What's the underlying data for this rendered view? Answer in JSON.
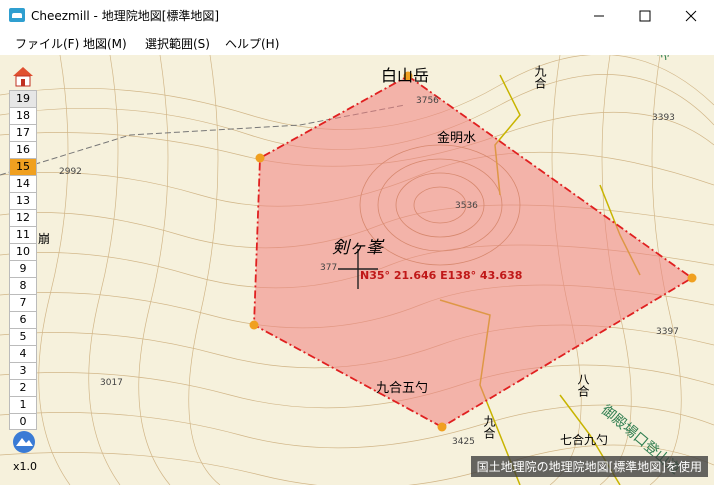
{
  "window": {
    "title": "Cheezmill - 地理院地図[標準地図]",
    "minimize_icon": "minimize-icon",
    "maximize_icon": "maximize-icon",
    "close_icon": "close-icon"
  },
  "menu": {
    "items": [
      {
        "label": "ファイル(F)"
      },
      {
        "label": "地図(M)"
      },
      {
        "label": "選択範囲(S)"
      },
      {
        "label": "ヘルプ(H)"
      }
    ]
  },
  "zoom": {
    "home_icon": "home-icon",
    "levels": [
      "19",
      "18",
      "17",
      "16",
      "15",
      "14",
      "13",
      "12",
      "11",
      "10",
      "9",
      "8",
      "7",
      "6",
      "5",
      "4",
      "3",
      "2",
      "1",
      "0"
    ],
    "active_level": "15",
    "globe_icon": "globe-icon",
    "factor": "x1.0"
  },
  "map": {
    "labels": {
      "hakusan": "白山岳",
      "kinmeisui": "金明水",
      "kengamine": "剣ヶ峯",
      "kugogoshaku": "九合五勺",
      "kugo_top": "九合",
      "kugo_bottom": "九合",
      "hachigo": "八合",
      "nanagoku": "七合九勺",
      "gotenba": "御殿場口登山道",
      "suso": "須走",
      "kuzure": "崩"
    },
    "elevations": {
      "e3756": "3756",
      "e3536": "3536",
      "e3393": "3393",
      "e2992": "2992",
      "e3397": "3397",
      "e3017": "3017",
      "e3425": "3425",
      "e377": "377"
    },
    "coordinate": "N35° 21.646 E138° 43.638",
    "attribution": "国土地理院の地理院地図[標準地図]を使用",
    "selection_color": "#f08080",
    "selection_stroke": "#e02020",
    "vertex_color": "#f0a020"
  }
}
